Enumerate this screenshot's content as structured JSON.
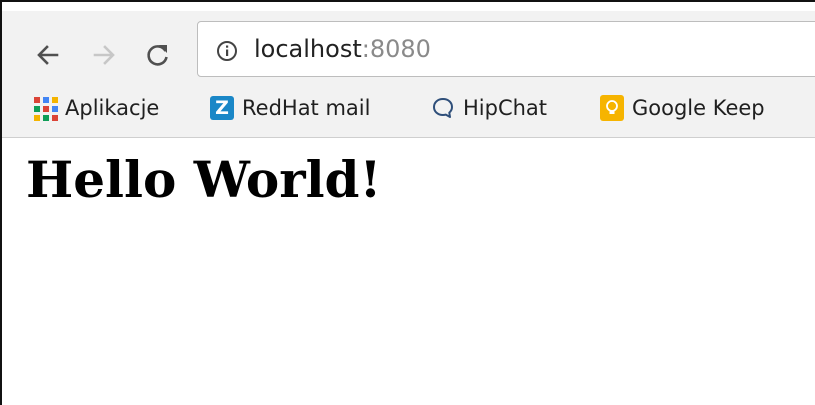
{
  "browser": {
    "url_host": "localhost",
    "url_port": ":8080",
    "buttons": {
      "back": "back-arrow-icon",
      "forward": "forward-arrow-icon",
      "reload": "reload-icon",
      "site_info": "info-icon"
    }
  },
  "bookmarks": [
    {
      "label": "Aplikacje",
      "icon": "apps-grid-icon"
    },
    {
      "label": "RedHat mail",
      "icon": "z-icon",
      "icon_text": "Z"
    },
    {
      "label": "HipChat",
      "icon": "chat-bubble-icon"
    },
    {
      "label": "Google Keep",
      "icon": "lightbulb-icon"
    }
  ],
  "page": {
    "heading": "Hello World!"
  },
  "colors": {
    "toolbar_bg": "#f2f2f2",
    "url_port": "#8a8a8a",
    "z_icon": "#1a87c7",
    "keep_icon": "#f6b400"
  }
}
